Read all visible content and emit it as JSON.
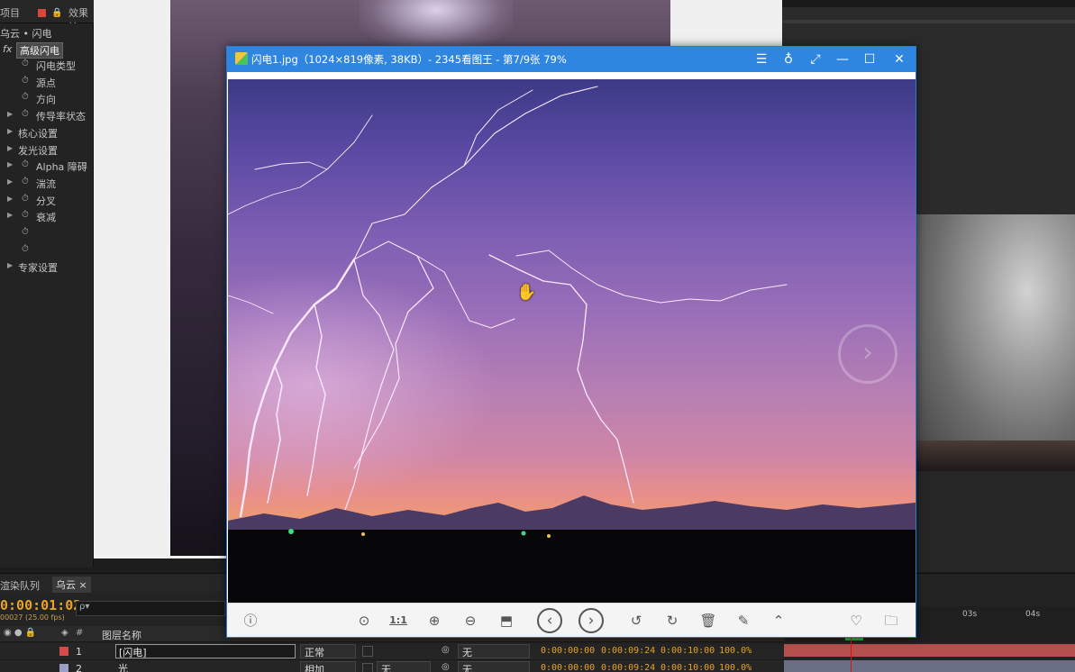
{
  "ae": {
    "tabs": {
      "project": "项目",
      "effects": "效果控"
    },
    "effects_panel": {
      "breadcrumb": "乌云 • 闪电",
      "fx_badge": "fx",
      "effect_name": "高级闪电",
      "properties": [
        {
          "label": "闪电类型",
          "twirl": ""
        },
        {
          "label": "源点",
          "twirl": ""
        },
        {
          "label": "方向",
          "twirl": ""
        },
        {
          "label": "传导率状态",
          "twirl": "▶"
        },
        {
          "label": "核心设置",
          "twirl": "▶"
        },
        {
          "label": "发光设置",
          "twirl": "▶"
        },
        {
          "label": "Alpha 障碍",
          "twirl": "▶"
        },
        {
          "label": "湍流",
          "twirl": "▶"
        },
        {
          "label": "分叉",
          "twirl": "▶"
        },
        {
          "label": "衰减",
          "twirl": "▶"
        },
        {
          "label": "",
          "twirl": ""
        },
        {
          "label": "",
          "twirl": ""
        },
        {
          "label": "专家设置",
          "twirl": "▶"
        }
      ]
    },
    "timeline": {
      "tab_render_queue": "渲染队列",
      "tab_comp": "乌云",
      "tab_close": "×",
      "timecode": "0:00:01:02",
      "fps_line": "00027 (25.00 fps)",
      "search_placeholder": "ρ▾",
      "header": {
        "hash": "#",
        "layer_name": "图层名称"
      },
      "layers": [
        {
          "num": "1",
          "name": "[闪电]",
          "mode": "正常",
          "trk": "",
          "parent": "无",
          "in": "0:00:00:00",
          "out": "0:00:09:24",
          "dur": "0:00:10:00",
          "stretch": "100.0%",
          "color": "#d64a4a"
        },
        {
          "num": "2",
          "name": "光",
          "mode": "相加",
          "trk": "无",
          "parent": "无",
          "in": "0:00:00:00",
          "out": "0:00:09:24",
          "dur": "0:00:10:00",
          "stretch": "100.0%",
          "color": "#9a9fc4"
        }
      ],
      "ruler_ticks": [
        "03s",
        "04s"
      ]
    }
  },
  "viewer": {
    "title": "闪电1.jpg（1024×819像素, 38KB）- 2345看图王 - 第7/9张 79%",
    "title_buttons": {
      "menu": "☰",
      "skin": "♁",
      "fullscreen": "⤢",
      "minimize": "—",
      "maximize": "☐",
      "close": "✕"
    },
    "next_arrow": "›",
    "cursor": "✋",
    "toolbar": {
      "info": "ⓘ",
      "mouse": "⊙",
      "actual_size": "1:1",
      "zoom_in": "⊕",
      "zoom_out": "⊖",
      "slideshow": "⬒",
      "prev": "‹",
      "next": "›",
      "rotate_left": "↺",
      "rotate_right": "↻",
      "delete": "🗑",
      "edit": "✎",
      "more": "⌃",
      "favorite": "♡",
      "folder": "🗀"
    }
  }
}
